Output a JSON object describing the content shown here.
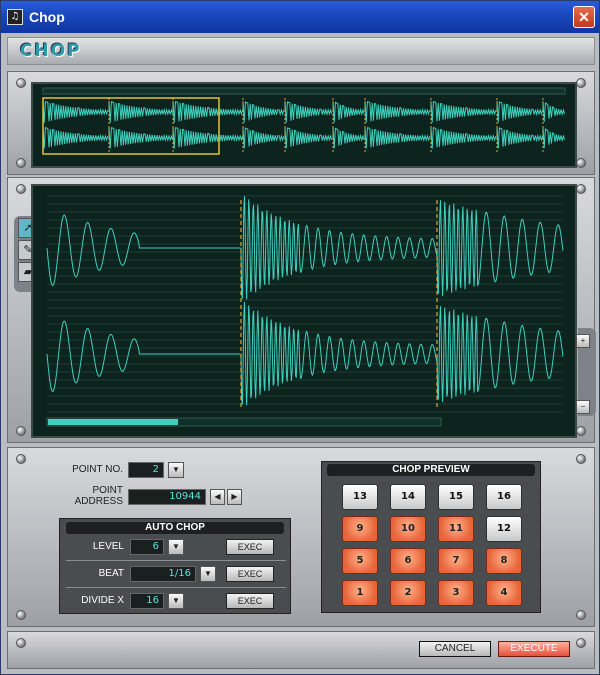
{
  "window": {
    "title": "Chop",
    "app_icon": "app-icon",
    "close": "✕"
  },
  "header": {
    "logo": "CHOP"
  },
  "editor": {
    "tools": [
      "arrow-icon",
      "pencil-icon",
      "eraser-icon"
    ]
  },
  "point": {
    "label_no": "POINT NO.",
    "no_value": "2",
    "label_address": "POINT\nADDRESS",
    "address_value": "10944"
  },
  "auto_chop": {
    "title": "AUTO CHOP",
    "rows": [
      {
        "label": "LEVEL",
        "value": "6",
        "exec": "EXEC"
      },
      {
        "label": "BEAT",
        "value": "1/16",
        "exec": "EXEC"
      },
      {
        "label": "DIVIDE X",
        "value": "16",
        "exec": "EXEC"
      }
    ]
  },
  "preview": {
    "title": "CHOP PREVIEW",
    "rows": [
      [
        "13",
        "14",
        "15",
        "16"
      ],
      [
        "9",
        "10",
        "11",
        "12"
      ],
      [
        "5",
        "6",
        "7",
        "8"
      ],
      [
        "1",
        "2",
        "3",
        "4"
      ]
    ]
  },
  "buttons": {
    "cancel": "CANCEL",
    "execute": "EXECUTE"
  },
  "colors": {
    "wave": "#3fd0bd",
    "marker": "#e2a23a",
    "accent": "#e8653b"
  }
}
